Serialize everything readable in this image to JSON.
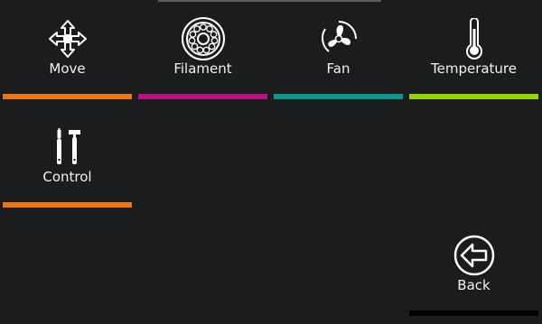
{
  "menu": {
    "items": [
      {
        "label": "Move",
        "icon": "move-arrows-icon",
        "accent": "#e8751a"
      },
      {
        "label": "Filament",
        "icon": "filament-spool-icon",
        "accent": "#b3137d"
      },
      {
        "label": "Fan",
        "icon": "fan-icon",
        "accent": "#12968a"
      },
      {
        "label": "Temperature",
        "icon": "thermometer-icon",
        "accent": "#92d40e"
      },
      {
        "label": "Control",
        "icon": "tools-icon",
        "accent": "#e8751a"
      }
    ],
    "back": {
      "label": "Back",
      "icon": "back-arrow-icon",
      "accent": "#000000"
    }
  }
}
